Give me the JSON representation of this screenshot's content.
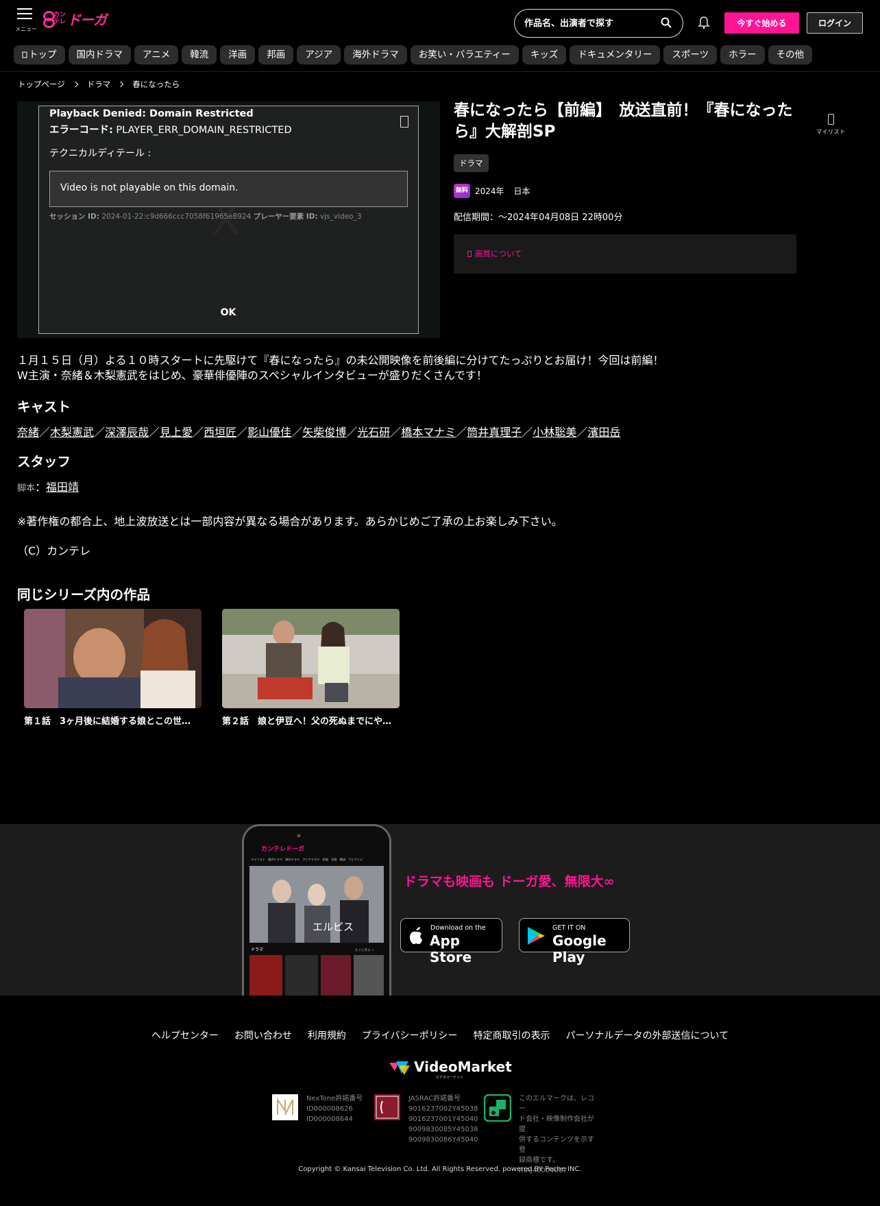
{
  "header": {
    "menu_label": "メニュー",
    "logo_small": "カンテレ",
    "logo_big": "ドーガ",
    "search_placeholder": "作品名、出演者で探す",
    "start_label": "今すぐ始める",
    "login_label": "ログイン"
  },
  "categories": [
    "トップ",
    "国内ドラマ",
    "アニメ",
    "韓流",
    "洋画",
    "邦画",
    "アジア",
    "海外ドラマ",
    "お笑い・バラエティー",
    "キッズ",
    "ドキュメンタリー",
    "スポーツ",
    "ホラー",
    "その他"
  ],
  "breadcrumb": [
    "トップページ",
    "ドラマ",
    "春になったら"
  ],
  "player": {
    "watermark": "X",
    "title": "Playback Denied: Domain Restricted",
    "code_label": "エラーコード:",
    "code": "PLAYER_ERR_DOMAIN_RESTRICTED",
    "tech_label": "テクニカルディテール :",
    "message": "Video is not playable on this domain.",
    "session_label": "セッション ID:",
    "session_id": "2024-01-22:c9d666ccc7058f61965e8924",
    "element_label": "プレーヤー要素 ID:",
    "element_id": "vjs_video_3",
    "ok_label": "OK"
  },
  "info": {
    "title": "春になったら【前編】　放送直前！『春になったら』大解剖SP",
    "genre": "ドラマ",
    "free_badge": "無料",
    "year": "2024年",
    "country": "日本",
    "period": "配信期間：〜2024年04月08日 22時00分",
    "quality_link": "画質について",
    "mylist_label": "マイリスト"
  },
  "description": [
    "１月１５日（月）よる１０時スタートに先駆けて『春になったら』の未公開映像を前後編に分けてたっぷりとお届け！今回は前編！",
    "W主演・奈緒＆木梨憲武をはじめ、豪華俳優陣のスペシャルインタビューが盛りだくさんです！"
  ],
  "cast": {
    "heading": "キャスト",
    "members": [
      "奈緒",
      "木梨憲武",
      "深澤辰哉",
      "見上愛",
      "西垣匠",
      "影山優佳",
      "矢柴俊博",
      "光石研",
      "橋本マナミ",
      "筒井真理子",
      "小林聡美",
      "濱田岳"
    ],
    "separator": "／"
  },
  "staff": {
    "heading": "スタッフ",
    "role": "脚本",
    "colon": "：",
    "name": "福田靖"
  },
  "notice": "※著作権の都合上、地上波放送とは一部内容が異なる場合があります。あらかじめご了承の上お楽しみ下さい。",
  "copyright_c": "（C）カンテレ",
  "series": {
    "heading": "同じシリーズ内の作品",
    "episodes": [
      {
        "caption": "第１話　3ヶ月後に結婚する娘とこの世…"
      },
      {
        "caption": "第２話　娘と伊豆へ！父の死ぬまでにや…"
      }
    ]
  },
  "promo": {
    "tagline": "ドラマも映画も ドーガ愛、無限大∞",
    "appstore_small": "Download on the",
    "appstore_big": "App Store",
    "google_small": "GET IT ON",
    "google_big": "Google Play",
    "phone_tabs": "マイリスト　国内ドラマ　海外ドラマ　アジアドラマ　邦画　洋画　韓流　ナビアニメ",
    "phone_show": "エルピス",
    "phone_section": "ドラマ",
    "phone_more": "もっと見る >"
  },
  "footer": {
    "links": [
      "ヘルプセンター",
      "お問い合わせ",
      "利用規約",
      "プライバシーポリシー",
      "特定商取引の表示",
      "パーソナルデータの外部送信について"
    ],
    "vm_name": "VideoMarket",
    "vm_sub": "ビデオマーケット",
    "nextone_lines": [
      "NexTone許諾番号",
      "ID000008626",
      "ID000008644"
    ],
    "jasrac_lines": [
      "JASRAC許諾番号",
      "9016237002Y45038",
      "9016237001Y45040",
      "9009830085Y45038",
      "9009830086Y45040"
    ],
    "lmark_lines": [
      "このエルマークは、レコー",
      "ド会社・映像制作会社が提",
      "供するコンテンツを示す登",
      "録商標です。",
      "RIAJ40004007"
    ],
    "copyright": "Copyright © Kansai Television Co. Ltd. All Rights Reserved. powered BY Peche INC."
  },
  "colors": {
    "accent": "#ff1493",
    "background": "#000000",
    "chip": "#2d2d2d"
  }
}
